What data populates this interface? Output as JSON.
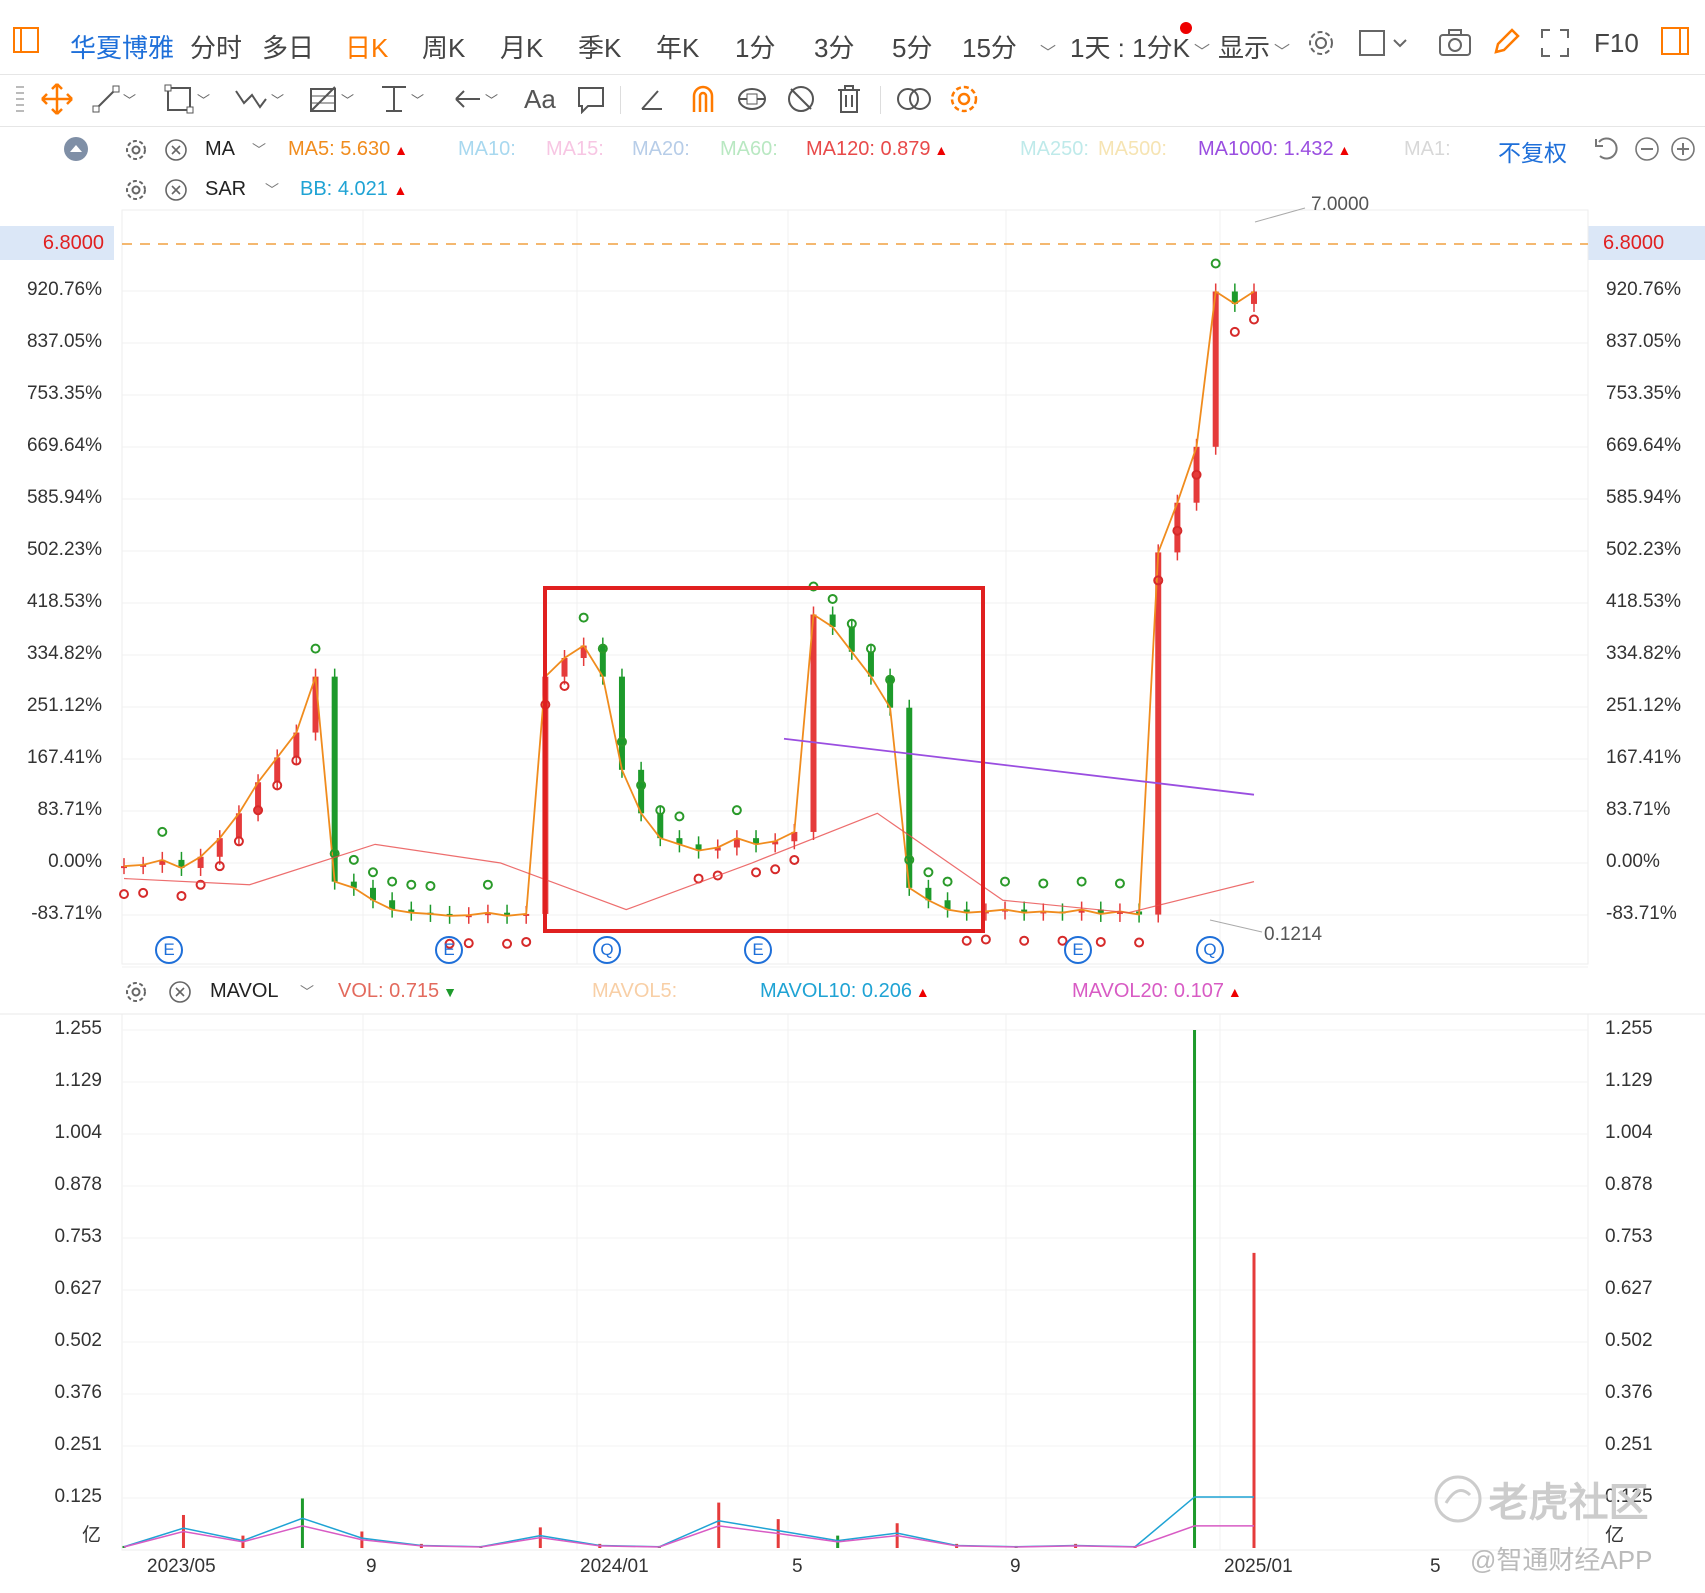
{
  "header": {
    "stock_name": "华夏博雅",
    "periods": [
      "分时",
      "多日",
      "日K",
      "周K",
      "月K",
      "季K",
      "年K",
      "1分",
      "3分",
      "5分",
      "15分"
    ],
    "active_period": "日K",
    "interval_label": "1天 : 1分K",
    "display_label": "显示",
    "f10_label": "F10"
  },
  "toolbar": {
    "text_tool_label": "Aa"
  },
  "indicators": {
    "ma": {
      "name": "MA",
      "items": [
        {
          "label": "MA5:",
          "value": "5.630",
          "color": "#f08c1e",
          "arrow": "▲"
        },
        {
          "label": "MA10:",
          "value": "",
          "color": "#a8d8ef",
          "arrow": ""
        },
        {
          "label": "MA15:",
          "value": "",
          "color": "#f7c6e3",
          "arrow": ""
        },
        {
          "label": "MA20:",
          "value": "",
          "color": "#b7cde8",
          "arrow": ""
        },
        {
          "label": "MA60:",
          "value": "",
          "color": "#b9e8c2",
          "arrow": ""
        },
        {
          "label": "MA120:",
          "value": "0.879",
          "color": "#e84a4a",
          "arrow": "▲"
        },
        {
          "label": "MA250:",
          "value": "",
          "color": "#bfeaea",
          "arrow": ""
        },
        {
          "label": "MA500:",
          "value": "",
          "color": "#f6e4b3",
          "arrow": ""
        },
        {
          "label": "MA1000:",
          "value": "1.432",
          "color": "#9a4ee0",
          "arrow": "▲"
        },
        {
          "label": "MA1:",
          "value": "",
          "color": "#d8d8d8",
          "arrow": ""
        }
      ],
      "adjust_label": "不复权"
    },
    "sar": {
      "name": "SAR",
      "bb_label": "BB:",
      "bb_value": "4.021",
      "bb_arrow": "▲"
    },
    "vol": {
      "name": "MAVOL",
      "items": [
        {
          "label": "VOL:",
          "value": "0.715",
          "color": "#e36a5d",
          "arrow": "▼"
        },
        {
          "label": "MAVOL5:",
          "value": "",
          "color": "#f8cfa6",
          "arrow": ""
        },
        {
          "label": "MAVOL10:",
          "value": "0.206",
          "color": "#1fa3d4",
          "arrow": "▲"
        },
        {
          "label": "MAVOL20:",
          "value": "0.107",
          "color": "#d85bc4",
          "arrow": "▲"
        }
      ]
    }
  },
  "price_axis": {
    "current_price": "6.8000",
    "labels": [
      "920.76%",
      "837.05%",
      "753.35%",
      "669.64%",
      "585.94%",
      "502.23%",
      "418.53%",
      "334.82%",
      "251.12%",
      "167.41%",
      "83.71%",
      "0.00%",
      "-83.71%"
    ],
    "max_label": "7.0000",
    "min_label": "0.1214"
  },
  "vol_axis": {
    "labels": [
      "1.255",
      "1.129",
      "1.004",
      "0.878",
      "0.753",
      "0.627",
      "0.502",
      "0.376",
      "0.251",
      "0.125"
    ],
    "unit": "亿"
  },
  "x_axis": {
    "labels": [
      "2023/05",
      "9",
      "2024/01",
      "5",
      "9",
      "2025/01",
      "5"
    ]
  },
  "event_markers": [
    "E",
    "E",
    "Q",
    "E",
    "E",
    "Q"
  ],
  "watermark": {
    "community": "老虎社区",
    "source": "@智通财经APP"
  },
  "chart_data": {
    "type": "line",
    "title": "",
    "candle_colors": {
      "up": "#e53b3b",
      "down": "#1d9a2b"
    },
    "close_pct_series": [
      -5,
      -3,
      5,
      -8,
      10,
      40,
      80,
      130,
      170,
      210,
      300,
      -30,
      -40,
      -60,
      -75,
      -80,
      -82,
      -85,
      -84,
      -80,
      -85,
      -82,
      300,
      330,
      350,
      300,
      150,
      80,
      40,
      30,
      20,
      25,
      40,
      30,
      35,
      50,
      400,
      380,
      340,
      300,
      250,
      -40,
      -60,
      -75,
      -80,
      -78,
      -75,
      -80,
      -78,
      -80,
      -75,
      -82,
      -78,
      -83,
      500,
      580,
      670,
      920,
      900,
      920
    ],
    "ma1000_pct": {
      "start": 200,
      "end": 110
    },
    "ma120_pct": [
      -25,
      -35,
      30,
      0,
      -75,
      0,
      80,
      -60,
      -80,
      -30
    ],
    "volume_yi": [
      0.005,
      0.08,
      0.03,
      0.12,
      0.04,
      0.01,
      0.005,
      0.05,
      0.01,
      0.005,
      0.11,
      0.07,
      0.03,
      0.06,
      0.01,
      0.005,
      0.01,
      0.005,
      1.255,
      0.715
    ],
    "mavol10_peak_yi": 0.206,
    "mavol20_peak_yi": 0.107,
    "price_high": 7.0,
    "price_low": 0.1214,
    "last_price": 6.8
  }
}
